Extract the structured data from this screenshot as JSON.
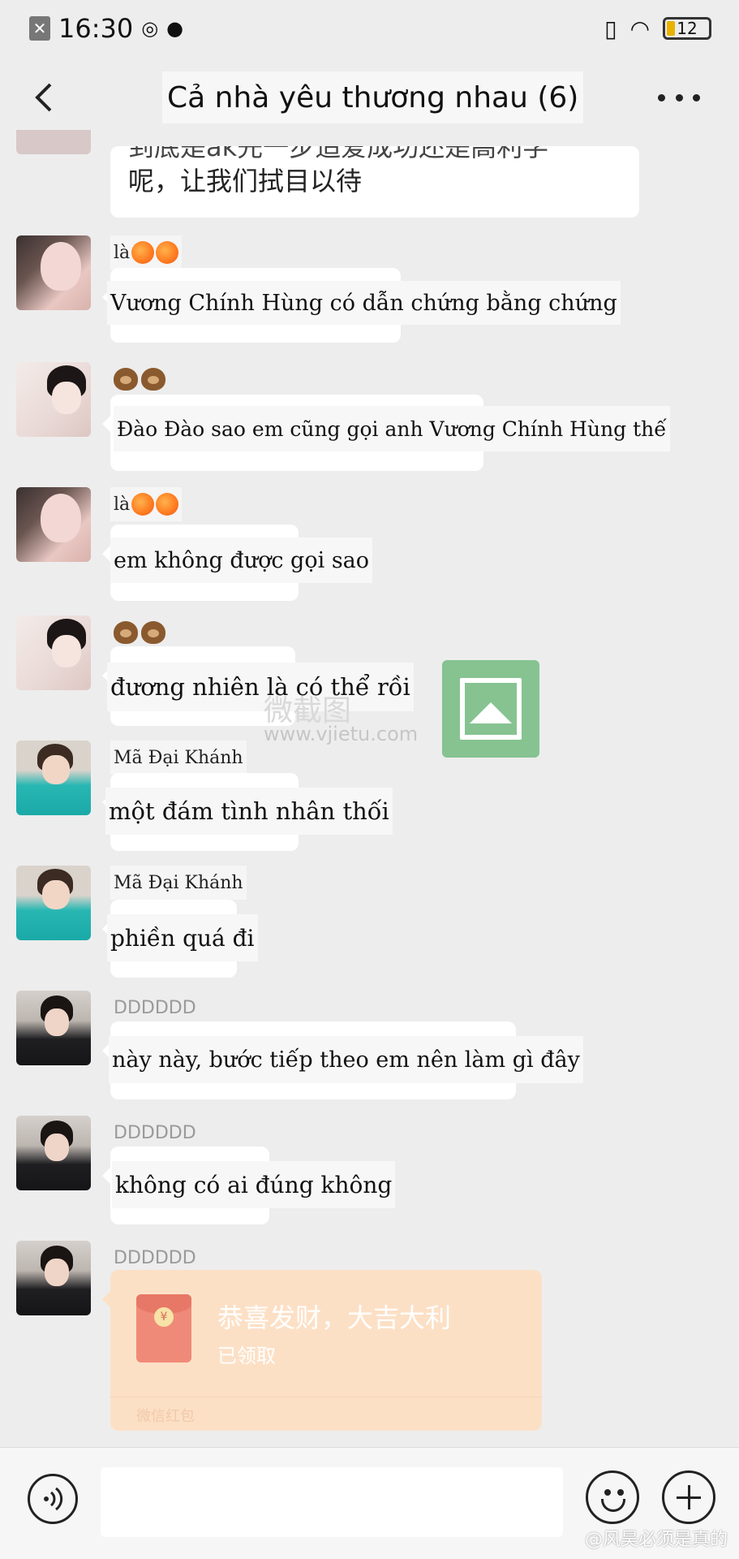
{
  "status_bar": {
    "time": "16:30",
    "battery": "12"
  },
  "header": {
    "title": "Cả nhà yêu thương nhau (6)"
  },
  "top_message": {
    "line1": "到底是ak先一步追爱成功还是高利学",
    "line2": "呢，让我们拭目以待"
  },
  "messages": [
    {
      "sender": "là",
      "text": "Vương Chính Hùng có dẫn chứng bằng chứng"
    },
    {
      "sender": "",
      "text": "Đào Đào sao em cũng gọi anh Vương Chính Hùng thế"
    },
    {
      "sender": "là",
      "text": "em không được gọi sao"
    },
    {
      "sender": "",
      "text": "đương nhiên là có thể rồi"
    },
    {
      "sender": "Mã Đại Khánh",
      "text": "một đám tình nhân thối"
    },
    {
      "sender": "Mã Đại Khánh",
      "text": "phiền quá đi"
    },
    {
      "sender": "DDDDDD",
      "text": "này này, bước tiếp theo em nên làm gì đây"
    },
    {
      "sender": "DDDDDD",
      "text": "không có ai đúng không"
    },
    {
      "sender": "DDDDDD",
      "text": ""
    }
  ],
  "watermark": {
    "site": "www.vjietu.com",
    "brand": "微截图"
  },
  "red_packet": {
    "title": "恭喜发财，大吉大利",
    "status": "已领取",
    "footer": "微信红包",
    "coin": "¥"
  },
  "weibo_watermark": "@风昊必须是真的",
  "colors": {
    "background": "#ededed",
    "bubble": "#ffffff",
    "red_packet": "#fce0c6"
  }
}
